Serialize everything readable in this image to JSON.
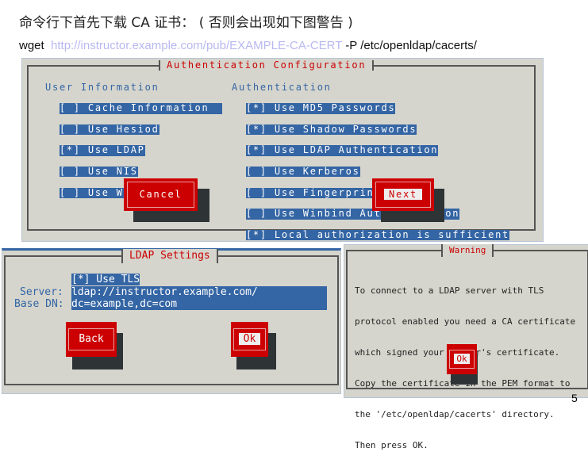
{
  "heading": "命令行下首先下载 CA 证书： ( 否则会出现如下图警告 )",
  "command": {
    "prefix": "wget ",
    "url": "http://instructor.example.com/pub/EXAMPLE-CA-CERT",
    "suffix": " -P /etc/openldap/cacerts/"
  },
  "auth": {
    "title": "Authentication Configuration",
    "user_info_label": "User Information",
    "user_info": [
      "[ ] Cache Information",
      "[ ] Use Hesiod",
      "[*] Use LDAP",
      "[ ] Use NIS",
      "[ ] Use Winbind"
    ],
    "auth_label": "Authentication",
    "auth_items": [
      "[*] Use MD5 Passwords",
      "[*] Use Shadow Passwords",
      "[*] Use LDAP Authentication",
      "[ ] Use Kerberos",
      "[ ] Use Fingerprint reader",
      "[ ] Use Winbind Authentication",
      "[*] Local authorization is sufficient"
    ],
    "cancel": "Cancel",
    "next": "Next"
  },
  "ldap": {
    "title": "LDAP Settings",
    "tls": "[*] Use TLS",
    "server_label": "Server:",
    "server_value": "ldap://instructor.example.com/",
    "basedn_label": "Base DN:",
    "basedn_value": "dc=example,dc=com",
    "back": "Back",
    "ok": "Ok"
  },
  "warning": {
    "title": "Warning",
    "lines": [
      "To connect to a LDAP server with TLS",
      "protocol enabled you need a CA certificate",
      "which signed your server's certificate.",
      "Copy the certificate in the PEM format to",
      "the '/etc/openldap/cacerts' directory.",
      "Then press OK."
    ],
    "ok": "Ok"
  },
  "page_number": "5",
  "colors": {
    "panel": "#d5d5cd",
    "selection": "#3465a4",
    "button": "#cc0000",
    "title": "#cc0000"
  }
}
